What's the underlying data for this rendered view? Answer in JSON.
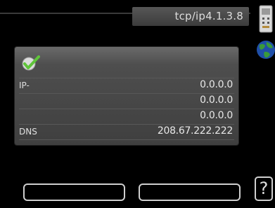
{
  "header": {
    "title": "tcp/ip4.1.3.8"
  },
  "icons": {
    "status": "check-icon",
    "network": "globe-icon",
    "device": "device-icon",
    "help": "help-icon"
  },
  "rows": [
    {
      "label": "IP-",
      "value": "0.0.0.0"
    },
    {
      "label": "",
      "value": "0.0.0.0"
    },
    {
      "label": "",
      "value": "0.0.0.0"
    },
    {
      "label": "DNS",
      "value": "208.67.222.222"
    }
  ],
  "footer": {
    "help_label": "?"
  },
  "colors": {
    "accent_green": "#5fc43a",
    "panel": "#4e4e4e",
    "background": "#000000"
  }
}
